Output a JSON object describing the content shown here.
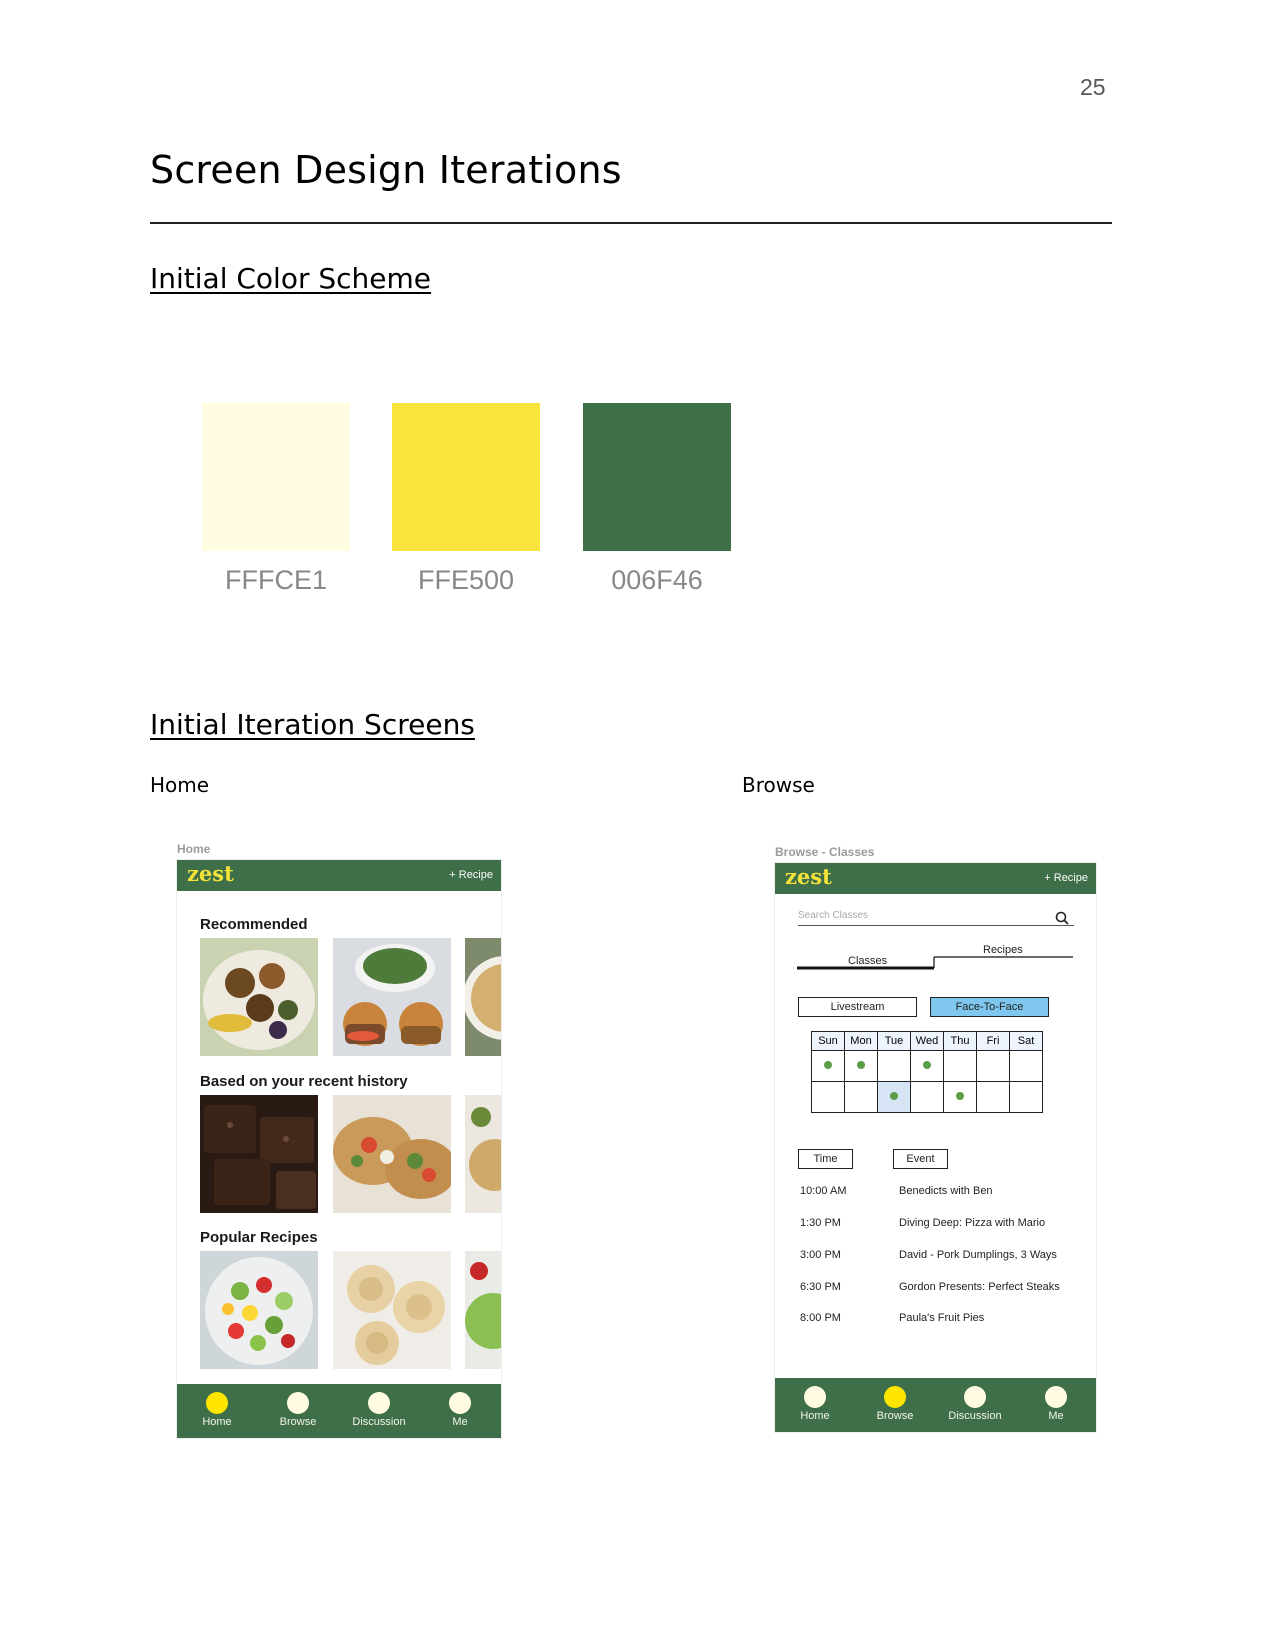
{
  "page_number": "25",
  "title": "Screen Design Iterations",
  "color_section": {
    "heading": "Initial Color Scheme",
    "swatches": [
      {
        "label": "FFFCE1",
        "color": "#FFFCE1"
      },
      {
        "label": "FFE500",
        "color": "#FFE500"
      },
      {
        "label": "006F46",
        "color": "#3E6F48"
      }
    ]
  },
  "screens_section": {
    "heading": "Initial Iteration Screens",
    "home_label": "Home",
    "browse_label": "Browse"
  },
  "home_screen": {
    "caption": "Home",
    "logo": "zest",
    "add_recipe": "+ Recipe",
    "sections": [
      "Recommended",
      "Based on your recent history",
      "Popular Recipes"
    ],
    "tabs": [
      "Home",
      "Browse",
      "Discussion",
      "Me"
    ],
    "active_tab": "Home"
  },
  "browse_screen": {
    "caption": "Browse - Classes",
    "logo": "zest",
    "add_recipe": "+ Recipe",
    "search_placeholder": "Search Classes",
    "segments": [
      "Classes",
      "Recipes"
    ],
    "filters": [
      "Livestream",
      "Face-To-Face"
    ],
    "active_filter": "Face-To-Face",
    "weekdays": [
      "Sun",
      "Mon",
      "Tue",
      "Wed",
      "Thu",
      "Fri",
      "Sat"
    ],
    "table_headers": [
      "Time",
      "Event"
    ],
    "events": [
      {
        "time": "10:00 AM",
        "name": "Benedicts with Ben"
      },
      {
        "time": "1:30 PM",
        "name": "Diving Deep: Pizza with Mario"
      },
      {
        "time": "3:00 PM",
        "name": "David - Pork Dumplings, 3 Ways"
      },
      {
        "time": "6:30 PM",
        "name": "Gordon Presents: Perfect Steaks"
      },
      {
        "time": "8:00 PM",
        "name": "Paula's Fruit Pies"
      }
    ],
    "tabs": [
      "Home",
      "Browse",
      "Discussion",
      "Me"
    ],
    "active_tab": "Browse"
  }
}
